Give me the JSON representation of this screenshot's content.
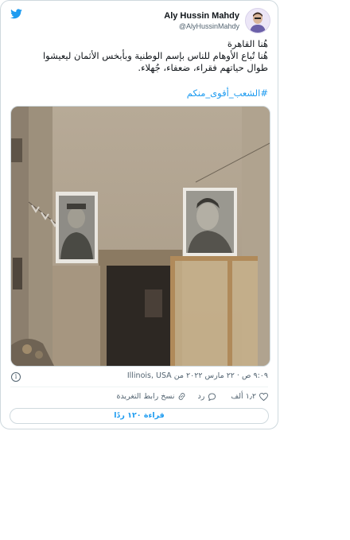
{
  "author": {
    "name": "Aly Hussin Mahdy",
    "handle": "@AlyHussinMahdy"
  },
  "tweet": {
    "lines": [
      "هُنا القاهرة",
      "هُنا تُباع الأوهام للناس بإسم الوطنية وبأبخس الأثمان ليعيشوا",
      "طوال حياتهم فقراء، ضعفاء، جُهلاء."
    ],
    "hashtag": "#الشعب_أقوى_منكم"
  },
  "meta": {
    "time_date": "٩:٠٩ ص · ٢٢ مارس ٢٠٢٢ من",
    "location": "Illinois, USA"
  },
  "actions": {
    "like_count": "١٫٢ ألف",
    "reply_label": "رد",
    "copy_link_label": "نسخ رابط التغريدة"
  },
  "read_replies": "قراءة ١٢٠ ردًا",
  "colors": {
    "accent": "#1d9bf0",
    "secondary_text": "#536471",
    "border": "#cfd9de"
  },
  "icons": [
    "twitter-bird-icon",
    "info-icon",
    "heart-icon",
    "reply-icon",
    "link-icon"
  ]
}
